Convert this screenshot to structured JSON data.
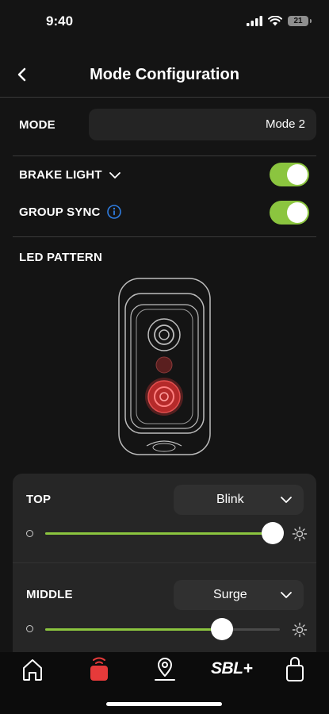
{
  "status_bar": {
    "time": "9:40",
    "battery": "21"
  },
  "header": {
    "title": "Mode Configuration",
    "back_icon": "chevron-left-icon"
  },
  "mode": {
    "label": "MODE",
    "value": "Mode 2"
  },
  "brake_light": {
    "label": "BRAKE LIGHT",
    "enabled": true
  },
  "group_sync": {
    "label": "GROUP SYNC",
    "enabled": true
  },
  "led_pattern": {
    "label": "LED PATTERN"
  },
  "zones": [
    {
      "label": "TOP",
      "pattern": "Blink",
      "brightness": 0.97
    },
    {
      "label": "MIDDLE",
      "pattern": "Surge",
      "brightness": 0.75
    }
  ],
  "tab_bar": {
    "items": [
      {
        "name": "home",
        "icon": "home-icon"
      },
      {
        "name": "device",
        "icon": "light-device-icon",
        "active": true
      },
      {
        "name": "location",
        "icon": "location-pin-icon"
      },
      {
        "name": "sbl-plus",
        "text": "SBL+"
      },
      {
        "name": "lock",
        "icon": "lock-icon"
      }
    ]
  },
  "colors": {
    "accent": "#8bc53f",
    "background": "#141414",
    "active_tab": "#e63a3a",
    "info": "#2f7de1"
  }
}
